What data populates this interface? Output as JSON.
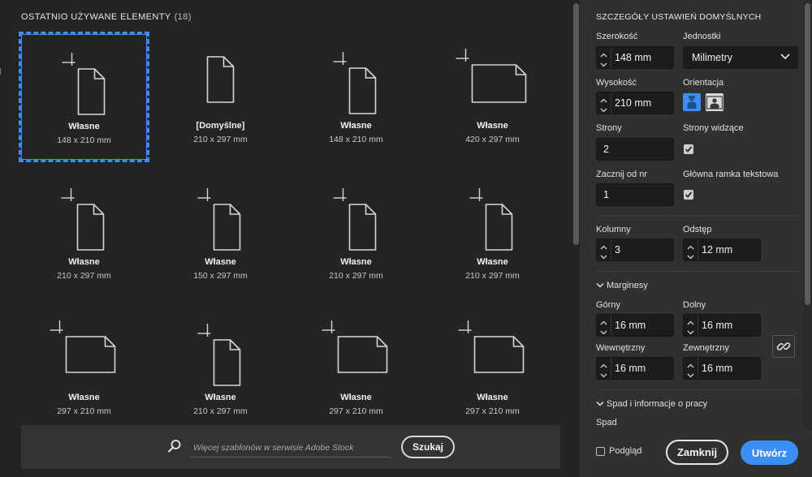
{
  "recent": {
    "title": "OSTATNIO UŻYWANE ELEMENTY",
    "count": "(18)",
    "items": [
      {
        "name": "Własne",
        "size": "148 x 210 mm",
        "orientation": "portrait",
        "icon": "custom-page-icon",
        "selected": true
      },
      {
        "name": "[Domyślne]",
        "size": "210 x 297 mm",
        "orientation": "portrait",
        "icon": "default-page-icon",
        "selected": false
      },
      {
        "name": "Własne",
        "size": "148 x 210 mm",
        "orientation": "portrait",
        "icon": "custom-page-icon",
        "selected": false
      },
      {
        "name": "Własne",
        "size": "420 x 297 mm",
        "orientation": "landscape",
        "icon": "custom-page-icon",
        "selected": false
      },
      {
        "name": "Własne",
        "size": "210 x 297 mm",
        "orientation": "portrait",
        "icon": "custom-page-icon",
        "selected": false
      },
      {
        "name": "Własne",
        "size": "150 x 297 mm",
        "orientation": "portrait",
        "icon": "custom-page-icon",
        "selected": false
      },
      {
        "name": "Własne",
        "size": "210 x 297 mm",
        "orientation": "portrait",
        "icon": "custom-page-icon",
        "selected": false
      },
      {
        "name": "Własne",
        "size": "210 x 297 mm",
        "orientation": "portrait",
        "icon": "custom-page-icon",
        "selected": false
      },
      {
        "name": "Własne",
        "size": "297 x 210 mm",
        "orientation": "landscape",
        "icon": "custom-page-icon",
        "selected": false
      },
      {
        "name": "Własne",
        "size": "210 x 297 mm",
        "orientation": "portrait",
        "icon": "custom-page-icon",
        "selected": false
      },
      {
        "name": "Własne",
        "size": "297 x 210 mm",
        "orientation": "landscape",
        "icon": "custom-page-icon",
        "selected": false
      },
      {
        "name": "Własne",
        "size": "297 x 210 mm",
        "orientation": "landscape",
        "icon": "custom-page-icon",
        "selected": false
      }
    ]
  },
  "search": {
    "placeholder": "Więcej szablonów w serwisie Adobe Stock",
    "button": "Szukaj"
  },
  "settings": {
    "title": "SZCZEGÓŁY USTAWIEŃ DOMYŚLNYCH",
    "width_label": "Szerokość",
    "width_value": "148 mm",
    "units_label": "Jednostki",
    "units_value": "Milimetry",
    "height_label": "Wysokość",
    "height_value": "210 mm",
    "orientation_label": "Orientacja",
    "orientation_selected": "portrait",
    "pages_label": "Strony",
    "pages_value": "2",
    "facing_label": "Strony widzące",
    "facing_checked": true,
    "start_label": "Zacznij od nr",
    "start_value": "1",
    "primary_frame_label": "Główna ramka tekstowa",
    "primary_frame_checked": true,
    "columns_label": "Kolumny",
    "columns_value": "3",
    "gutter_label": "Odstęp",
    "gutter_value": "12 mm",
    "margins_section": "Marginesy",
    "top_label": "Górny",
    "top_value": "16 mm",
    "bottom_label": "Dolny",
    "bottom_value": "16 mm",
    "inside_label": "Wewnętrzny",
    "inside_value": "16 mm",
    "outside_label": "Zewnętrzny",
    "outside_value": "16 mm",
    "bleed_section": "Spad i informacje o pracy",
    "bleed_label": "Spad"
  },
  "footer": {
    "preview_label": "Podgląd",
    "close_button": "Zamknij",
    "create_button": "Utwórz"
  },
  "colors": {
    "accent": "#3a8ef5",
    "panel_bg": "#303030",
    "main_bg": "#242424"
  }
}
